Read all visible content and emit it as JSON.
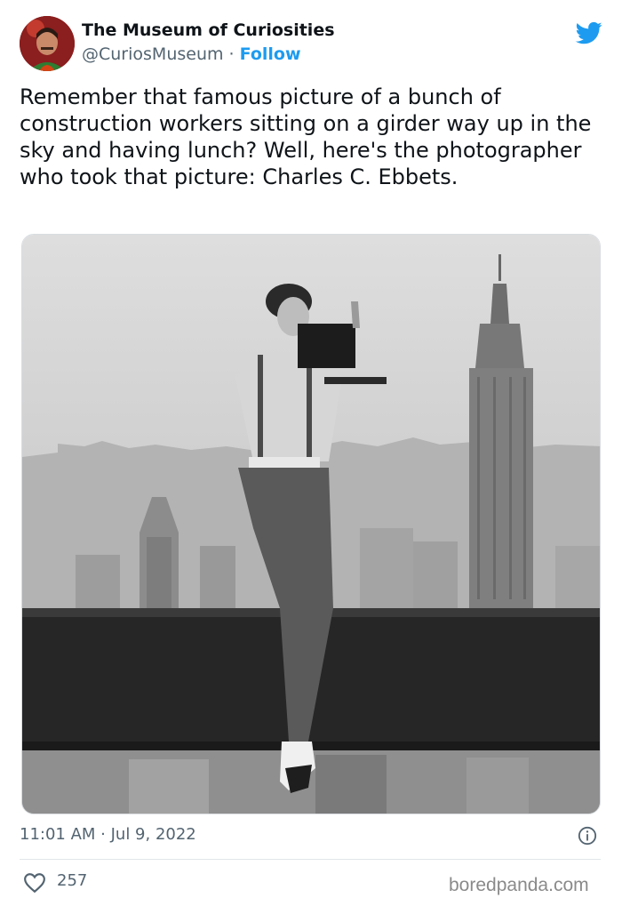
{
  "author": {
    "display_name": "The Museum of Curiosities",
    "handle": "@CuriosMuseum",
    "separator": " · ",
    "follow_label": "Follow"
  },
  "tweet": {
    "text": "Remember that famous picture of a bunch of construction workers sitting on a girder way up in the sky and having lunch? Well, here's the photographer who took that picture: Charles C. Ebbets.",
    "timestamp": "11:01 AM · Jul 9, 2022",
    "like_count": "257"
  },
  "icons": {
    "platform": "twitter-bird-icon",
    "info": "info-icon",
    "like": "heart-icon"
  },
  "colors": {
    "accent": "#1d9bf0",
    "secondary_text": "#536471"
  },
  "watermark": "boredpanda.com"
}
